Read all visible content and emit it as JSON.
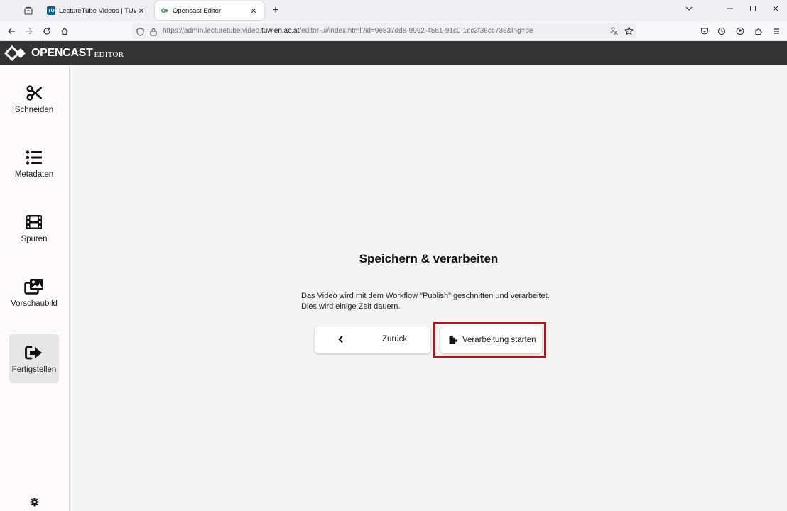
{
  "browser": {
    "tabs": [
      {
        "title": "LectureTube Videos | TUWEL",
        "favicon_text": "TU",
        "active": false
      },
      {
        "title": "Opencast Editor",
        "active": true
      }
    ],
    "url_prefix": "https://admin.lecturetube.video.",
    "url_domain": "tuwien.ac.at",
    "url_suffix": "/editor-ui/index.html?id=9e837dd8-9992-4561-91c0-1cc3f36cc736&lng=de"
  },
  "header": {
    "logo_main": "OPENCAST",
    "logo_sub": "EDITOR"
  },
  "sidebar": {
    "items": [
      {
        "label": "Schneiden",
        "icon": "scissors-icon",
        "active": false
      },
      {
        "label": "Metadaten",
        "icon": "list-icon",
        "active": false
      },
      {
        "label": "Spuren",
        "icon": "film-icon",
        "active": false
      },
      {
        "label": "Vorschaubild",
        "icon": "images-icon",
        "active": false
      },
      {
        "label": "Fertigstellen",
        "icon": "sign-out-icon",
        "active": true
      }
    ],
    "settings_icon": "gear-icon"
  },
  "main": {
    "heading": "Speichern & verarbeiten",
    "description_line1": "Das Video wird mit dem Workflow \"Publish\" geschnitten und verarbeitet.",
    "description_line2": "Dies wird einige Zeit dauern.",
    "back_label": "Zurück",
    "start_label": "Verarbeitung starten"
  },
  "colors": {
    "header_bg": "#333333",
    "highlight": "#b0141f",
    "active_item_bg": "#e6e6e6"
  }
}
